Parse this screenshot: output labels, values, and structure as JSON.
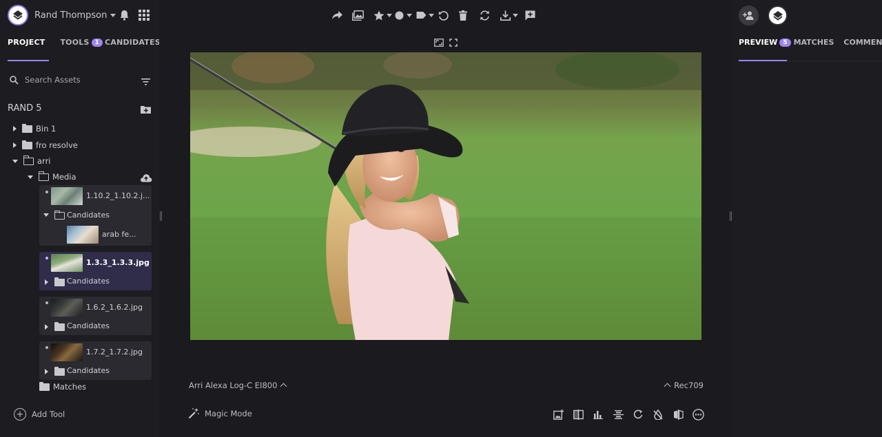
{
  "user": {
    "name": "Rand Thompson"
  },
  "left_tabs": [
    {
      "label": "PROJECT",
      "active": true
    },
    {
      "label": "TOOLS",
      "badge": "1"
    },
    {
      "label": "CANDIDATES"
    }
  ],
  "search": {
    "placeholder": "Search Assets"
  },
  "project": {
    "name": "RAND 5",
    "tree": [
      {
        "label": "Bin 1"
      },
      {
        "label": "fro resolve"
      },
      {
        "label": "arri"
      },
      {
        "label": "Media"
      },
      {
        "label": "Matches"
      }
    ]
  },
  "assets": [
    {
      "file": "1.10.2_1.10.2.j...",
      "subfolder": "Candidates",
      "child": "arab fe..."
    },
    {
      "file": "1.3.3_1.3.3.jpg",
      "subfolder": "Candidates",
      "selected": true
    },
    {
      "file": "1.6.2_1.6.2.jpg",
      "subfolder": "Candidates"
    },
    {
      "file": "1.7.2_1.7.2.jpg",
      "subfolder": "Candidates"
    }
  ],
  "add_tool": "Add Tool",
  "color": {
    "input_space": "Arri Alexa Log-C EI800",
    "output_space": "Rec709"
  },
  "magic_mode": "Magic Mode",
  "right_tabs": [
    {
      "label": "PREVIEW",
      "badge": "5",
      "active": true
    },
    {
      "label": "MATCHES"
    },
    {
      "label": "COMMENTS"
    }
  ],
  "colors": {
    "accent": "#9d85f0",
    "bg": "#1d1c21",
    "canvas": "#1b1a1f"
  }
}
